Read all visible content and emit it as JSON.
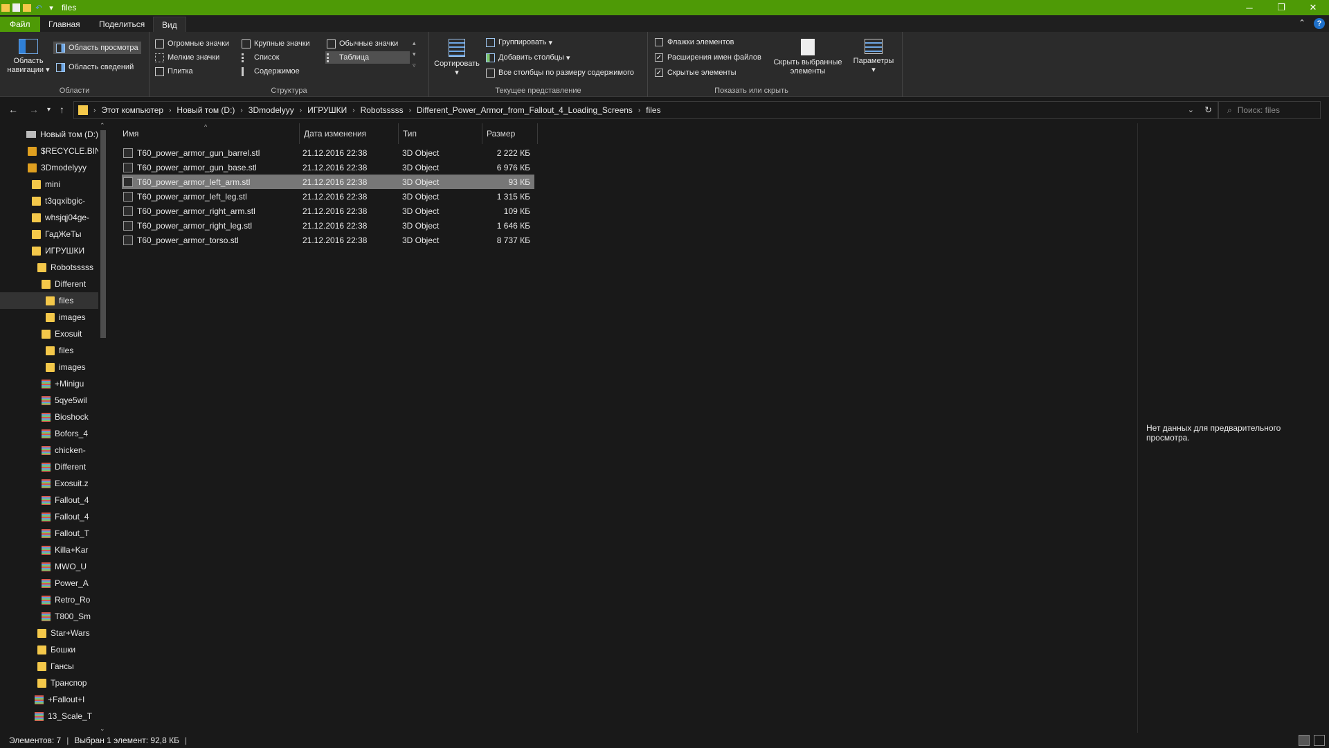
{
  "window": {
    "title": "files",
    "controls": [
      "─",
      "❐",
      "✕"
    ]
  },
  "tabs": [
    {
      "label": "Файл"
    },
    {
      "label": "Главная"
    },
    {
      "label": "Поделиться"
    },
    {
      "label": "Вид"
    }
  ],
  "ribbon": {
    "areas": {
      "nav_pane": "Область навигации",
      "preview_pane": "Область просмотра",
      "details_pane": "Область сведений",
      "label": "Области"
    },
    "layout": {
      "items": [
        "Огромные значки",
        "Крупные значки",
        "Обычные значки",
        "Мелкие значки",
        "Список",
        "Таблица",
        "Плитка",
        "Содержимое"
      ],
      "selected": "Таблица",
      "label": "Структура"
    },
    "current_view": {
      "sort": "Сортировать",
      "group": "Группировать",
      "add_columns": "Добавить столбцы",
      "fit_columns": "Все столбцы по размеру содержимого",
      "label": "Текущее представление"
    },
    "show_hide": {
      "item_checkboxes": {
        "label": "Флажки элементов",
        "checked": false
      },
      "file_extensions": {
        "label": "Расширения имен файлов",
        "checked": true
      },
      "hidden_items": {
        "label": "Скрытые элементы",
        "checked": true
      },
      "hide_selected": "Скрыть выбранные элементы",
      "label": "Показать или скрыть"
    },
    "options": "Параметры"
  },
  "address": {
    "crumbs": [
      "Этот компьютер",
      "Новый том (D:)",
      "3Dmodelyyy",
      "ИГРУШКИ",
      "Robotsssss",
      "Different_Power_Armor_from_Fallout_4_Loading_Screens",
      "files"
    ],
    "search_placeholder": "Поиск: files"
  },
  "navpane": {
    "items": [
      {
        "label": "Новый том (D:)",
        "type": "drive"
      },
      {
        "label": "$RECYCLE.BIN",
        "type": "folder-dark"
      },
      {
        "label": "3Dmodelyyy",
        "type": "folder-dark"
      },
      {
        "label": "mini",
        "type": "folder"
      },
      {
        "label": "t3qqxibgic-",
        "type": "folder"
      },
      {
        "label": "whsjqj04ge-",
        "type": "folder"
      },
      {
        "label": "ГадЖеТы",
        "type": "folder"
      },
      {
        "label": "ИГРУШКИ",
        "type": "folder"
      },
      {
        "label": "Robotsssss",
        "type": "folder"
      },
      {
        "label": "Different",
        "type": "folder"
      },
      {
        "label": "files",
        "type": "folder",
        "selected": true
      },
      {
        "label": "images",
        "type": "folder"
      },
      {
        "label": "Exosuit",
        "type": "folder"
      },
      {
        "label": "files",
        "type": "folder"
      },
      {
        "label": "images",
        "type": "folder"
      },
      {
        "label": "+Minigu",
        "type": "archive"
      },
      {
        "label": "5qye5wil",
        "type": "archive"
      },
      {
        "label": "Bioshock",
        "type": "archive"
      },
      {
        "label": "Bofors_4",
        "type": "archive"
      },
      {
        "label": "chicken-",
        "type": "archive"
      },
      {
        "label": "Different",
        "type": "archive"
      },
      {
        "label": "Exosuit.z",
        "type": "archive"
      },
      {
        "label": "Fallout_4",
        "type": "archive"
      },
      {
        "label": "Fallout_4",
        "type": "archive"
      },
      {
        "label": "Fallout_T",
        "type": "archive"
      },
      {
        "label": "Killa+Kar",
        "type": "archive"
      },
      {
        "label": "MWO_U",
        "type": "archive"
      },
      {
        "label": "Power_A",
        "type": "archive"
      },
      {
        "label": "Retro_Ro",
        "type": "archive"
      },
      {
        "label": "T800_Sm",
        "type": "archive"
      },
      {
        "label": "Star+Wars",
        "type": "folder"
      },
      {
        "label": "Бошки",
        "type": "folder"
      },
      {
        "label": "Гансы",
        "type": "folder"
      },
      {
        "label": "Транспор",
        "type": "folder"
      },
      {
        "label": "+Fallout+I",
        "type": "archive"
      },
      {
        "label": "13_Scale_T",
        "type": "archive"
      }
    ]
  },
  "columns": [
    "Имя",
    "Дата изменения",
    "Тип",
    "Размер"
  ],
  "files": [
    {
      "name": "T60_power_armor_gun_barrel.stl",
      "date": "21.12.2016 22:38",
      "type": "3D Object",
      "size": "2 222 КБ"
    },
    {
      "name": "T60_power_armor_gun_base.stl",
      "date": "21.12.2016 22:38",
      "type": "3D Object",
      "size": "6 976 КБ"
    },
    {
      "name": "T60_power_armor_left_arm.stl",
      "date": "21.12.2016 22:38",
      "type": "3D Object",
      "size": "93 КБ",
      "selected": true
    },
    {
      "name": "T60_power_armor_left_leg.stl",
      "date": "21.12.2016 22:38",
      "type": "3D Object",
      "size": "1 315 КБ"
    },
    {
      "name": "T60_power_armor_right_arm.stl",
      "date": "21.12.2016 22:38",
      "type": "3D Object",
      "size": "109 КБ"
    },
    {
      "name": "T60_power_armor_right_leg.stl",
      "date": "21.12.2016 22:38",
      "type": "3D Object",
      "size": "1 646 КБ"
    },
    {
      "name": "T60_power_armor_torso.stl",
      "date": "21.12.2016 22:38",
      "type": "3D Object",
      "size": "8 737 КБ"
    }
  ],
  "preview": {
    "message": "Нет данных для предварительного просмотра."
  },
  "status": {
    "count": "Элементов: 7",
    "selection": "Выбран 1 элемент: 92,8 КБ"
  }
}
